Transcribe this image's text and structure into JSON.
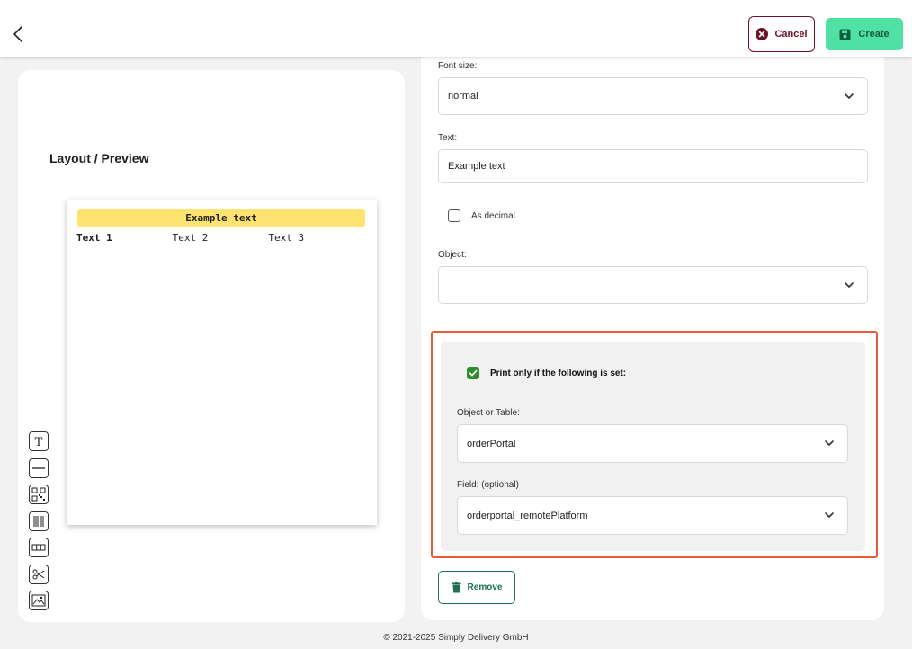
{
  "header": {
    "cancel_label": "Cancel",
    "create_label": "Create"
  },
  "preview": {
    "title": "Layout / Preview",
    "header_text": "Example text",
    "columns": [
      "Text 1",
      "Text 2",
      "Text 3"
    ]
  },
  "toolbox": [
    "text-tool-icon",
    "line-tool-icon",
    "qr-code-tool-icon",
    "barcode-tool-icon",
    "table-tool-icon",
    "cut-tool-icon",
    "image-tool-icon"
  ],
  "form": {
    "font_size_label": "Font size:",
    "font_size_value": "normal",
    "text_label": "Text:",
    "text_value": "Example text",
    "as_decimal_label": "As decimal",
    "as_decimal_checked": false,
    "object_label": "Object:",
    "object_value": "",
    "condition": {
      "checkbox_label": "Print only if the following is set:",
      "checked": true,
      "object_table_label": "Object or Table:",
      "object_table_value": "orderPortal",
      "field_label": "Field: (optional)",
      "field_value": "orderportal_remotePlatform"
    },
    "remove_label": "Remove"
  },
  "footer": {
    "copyright": "© 2021-2025 Simply Delivery GmbH"
  },
  "colors": {
    "accent_green": "#4fe0a4",
    "cancel_maroon": "#6b1228",
    "highlight_border": "#e8593c",
    "preview_header_yellow": "#fde36f"
  }
}
